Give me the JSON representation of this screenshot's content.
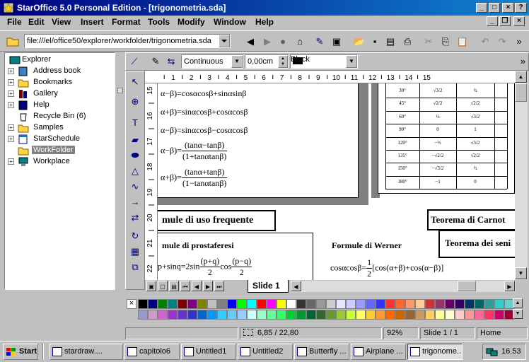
{
  "window": {
    "title": "StarOffice 5.0 Personal Edition - [trigonometria.sda]",
    "controls": {
      "minimize": "_",
      "maximize": "□",
      "close": "×"
    }
  },
  "menu": [
    "File",
    "Edit",
    "View",
    "Insert",
    "Format",
    "Tools",
    "Modify",
    "Window",
    "Help"
  ],
  "url": {
    "value": "file:///el/office50/explorer/workfolder/trigonometria.sda"
  },
  "explorer": {
    "items": [
      {
        "label": "Explorer",
        "icon": "explorer-icon",
        "expander": ""
      },
      {
        "label": "Address book",
        "icon": "address-book-icon",
        "expander": "+"
      },
      {
        "label": "Bookmarks",
        "icon": "bookmarks-icon",
        "expander": "+"
      },
      {
        "label": "Gallery",
        "icon": "gallery-icon",
        "expander": "+"
      },
      {
        "label": "Help",
        "icon": "help-book-icon",
        "expander": "+"
      },
      {
        "label": "Recycle Bin (6)",
        "icon": "recycle-bin-icon",
        "expander": ""
      },
      {
        "label": "Samples",
        "icon": "folder-icon",
        "expander": "+"
      },
      {
        "label": "StarSchedule",
        "icon": "schedule-icon",
        "expander": "+"
      },
      {
        "label": "WorkFolder",
        "icon": "folder-icon",
        "expander": ""
      },
      {
        "label": "Workplace",
        "icon": "workplace-icon",
        "expander": "+"
      }
    ]
  },
  "drawbar": {
    "line_style": "Continuous",
    "line_width": "0,00cm",
    "line_color": "Black",
    "line_color_hex": "#000000"
  },
  "ruler": {
    "h_ticks": [
      "1",
      "2",
      "3",
      "4",
      "5",
      "6",
      "7",
      "8",
      "9",
      "10",
      "11",
      "12",
      "13",
      "14",
      "15"
    ],
    "v_ticks": [
      "15",
      "16",
      "17",
      "18",
      "19",
      "20",
      "21",
      "22"
    ]
  },
  "slide": {
    "formulas_left": [
      "α−β)=cosαcosβ+sinαsinβ",
      "α+β)=sinαcosβ+cosαcosβ",
      "α−β)=sinαcosβ−cosαcosβ"
    ],
    "tan_minus": {
      "prefix": "α−β)=",
      "num": "(tanα−tanβ)",
      "den": "(1+tanαtanβ)"
    },
    "tan_plus": {
      "prefix": "α+β)=",
      "num": "(tanα+tanβ)",
      "den": "(1−tanαtanβ)"
    },
    "angle_table": [
      [
        "30°",
        "√3/2",
        "½"
      ],
      [
        "45°",
        "√2/2",
        "√2/2"
      ],
      [
        "60°",
        "½",
        "√3/2"
      ],
      [
        "90°",
        "0",
        "1"
      ],
      [
        "120°",
        "−½",
        "√3/2"
      ],
      [
        "135°",
        "−√2/2",
        "√2/2"
      ],
      [
        "150°",
        "−√3/2",
        "½"
      ],
      [
        "180°",
        "−1",
        "0"
      ]
    ],
    "section_title": "mule di uso frequente",
    "prostaferesi_title": "mule di prostaferesi",
    "prostaferesi_formula": {
      "prefix": "p+sinq=2sin",
      "num1": "(p+q)",
      "den1": "2",
      "mid": "cos",
      "num2": "(p−q)",
      "den2": "2"
    },
    "werner_title": "Formule di Werner",
    "werner_formula": {
      "prefix": "cosαcosβ=",
      "num": "1",
      "den": "2",
      "suffix": "[cos(α+β)+cos(α−β)]"
    },
    "carnot_title": "Teorema di Carnot",
    "seni_title": "Teorema dei seni"
  },
  "tabs": {
    "slide_label": "Slide 1"
  },
  "palette": {
    "row1": [
      "#000000",
      "#000080",
      "#008000",
      "#008080",
      "#800000",
      "#800080",
      "#808000",
      "#c0c0c0",
      "#808080",
      "#0000ff",
      "#00ff00",
      "#00ffff",
      "#ff0000",
      "#ff00ff",
      "#ffff00",
      "#ffffff",
      "#333333",
      "#666666",
      "#999999",
      "#cccccc",
      "#e6e6ff",
      "#ccccff",
      "#9999ff",
      "#6666ff",
      "#3333ff",
      "#ff3333",
      "#ff6633",
      "#ff9966",
      "#ffcc99",
      "#cc3333",
      "#993366",
      "#660066",
      "#330066",
      "#003366",
      "#006666",
      "#339999",
      "#33cccc",
      "#66cccc"
    ],
    "row2": [
      "#9999cc",
      "#cc99cc",
      "#cc66cc",
      "#9933cc",
      "#6633cc",
      "#3333cc",
      "#0066cc",
      "#0099ff",
      "#33ccff",
      "#66ccff",
      "#99ccff",
      "#ccffff",
      "#99ffcc",
      "#66ff99",
      "#33ff66",
      "#00cc33",
      "#009933",
      "#006633",
      "#336633",
      "#669933",
      "#99cc33",
      "#ccff33",
      "#ffff66",
      "#ffcc33",
      "#ff9933",
      "#ff6600",
      "#cc6600",
      "#996633",
      "#cc9966",
      "#ffcc66",
      "#ffff99",
      "#ffffcc",
      "#ffcccc",
      "#ff9999",
      "#ff6699",
      "#ff3366",
      "#cc0066",
      "#990033"
    ]
  },
  "status": {
    "coords": "6,85 / 22,80",
    "zoom": "92%",
    "slide": "Slide 1 / 1",
    "mode": "Home"
  },
  "taskbar": {
    "start_label": "Start",
    "tasks": [
      "stardraw....",
      "capitolo6",
      "Untitled1",
      "Untitled2",
      "Butterfly ...",
      "Airplane ...",
      "trigonome..."
    ],
    "clock": "16.53"
  }
}
